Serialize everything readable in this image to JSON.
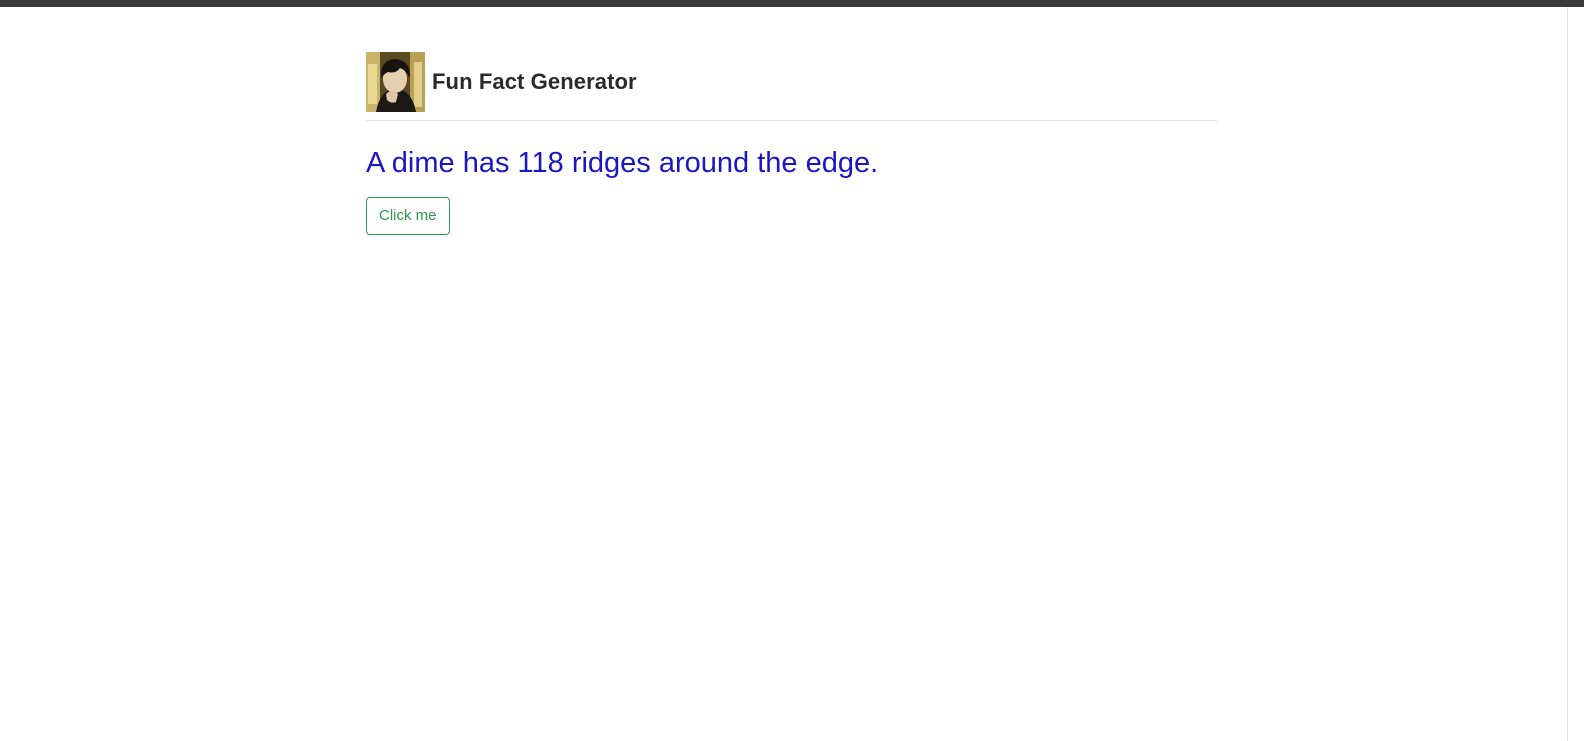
{
  "header": {
    "title": "Fun Fact Generator",
    "avatar_icon": "avatar-portrait"
  },
  "main": {
    "fact_text": "A dime has 118 ridges around the edge.",
    "button_label": "Click me"
  },
  "colors": {
    "fact": "#1a16c8",
    "button": "#2d9a4f",
    "title": "#2a2a2a",
    "top_bar": "#3a3a3a"
  }
}
